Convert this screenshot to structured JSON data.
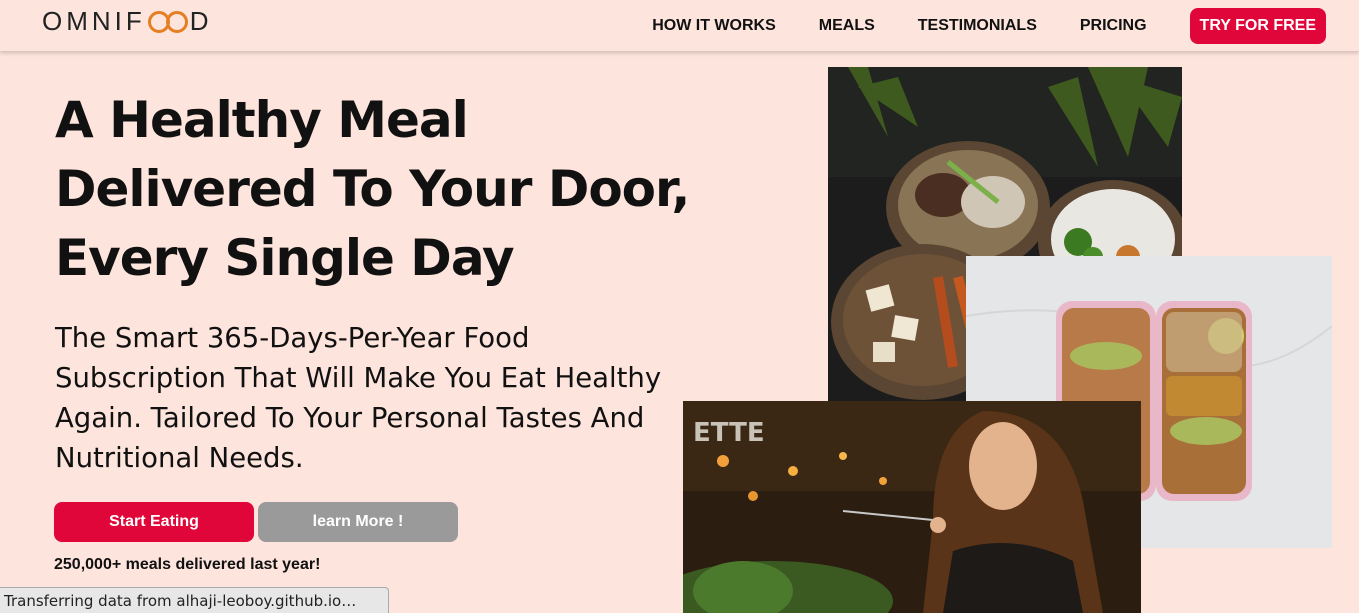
{
  "header": {
    "logo_left": "OMNIF",
    "logo_right": "D",
    "nav": [
      {
        "label": "HOW IT WORKS"
      },
      {
        "label": "MEALS"
      },
      {
        "label": "TESTIMONIALS"
      },
      {
        "label": "PRICING"
      }
    ],
    "cta_label": "TRY FOR FREE"
  },
  "hero": {
    "headline_lines": [
      "A Healthy Meal",
      "Delivered To Your Door,",
      "Every Single Day"
    ],
    "subline_lines": [
      "The Smart 365-Days-Per-Year Food",
      "Subscription That Will Make You Eat Healthy",
      "Again. Tailored To Your Personal Tastes And",
      "Nutritional Needs."
    ],
    "primary_button": "Start Eating",
    "secondary_button": "learn More !",
    "stat_text": "250,000+ meals delivered last year!"
  },
  "status_bar": {
    "text": "Transferring data from alhaji-leoboy.github.io…"
  },
  "colors": {
    "background": "#fde4dc",
    "accent": "#e0063a",
    "secondary_button": "#9a9a9a",
    "logo_accent": "#e67e22"
  }
}
